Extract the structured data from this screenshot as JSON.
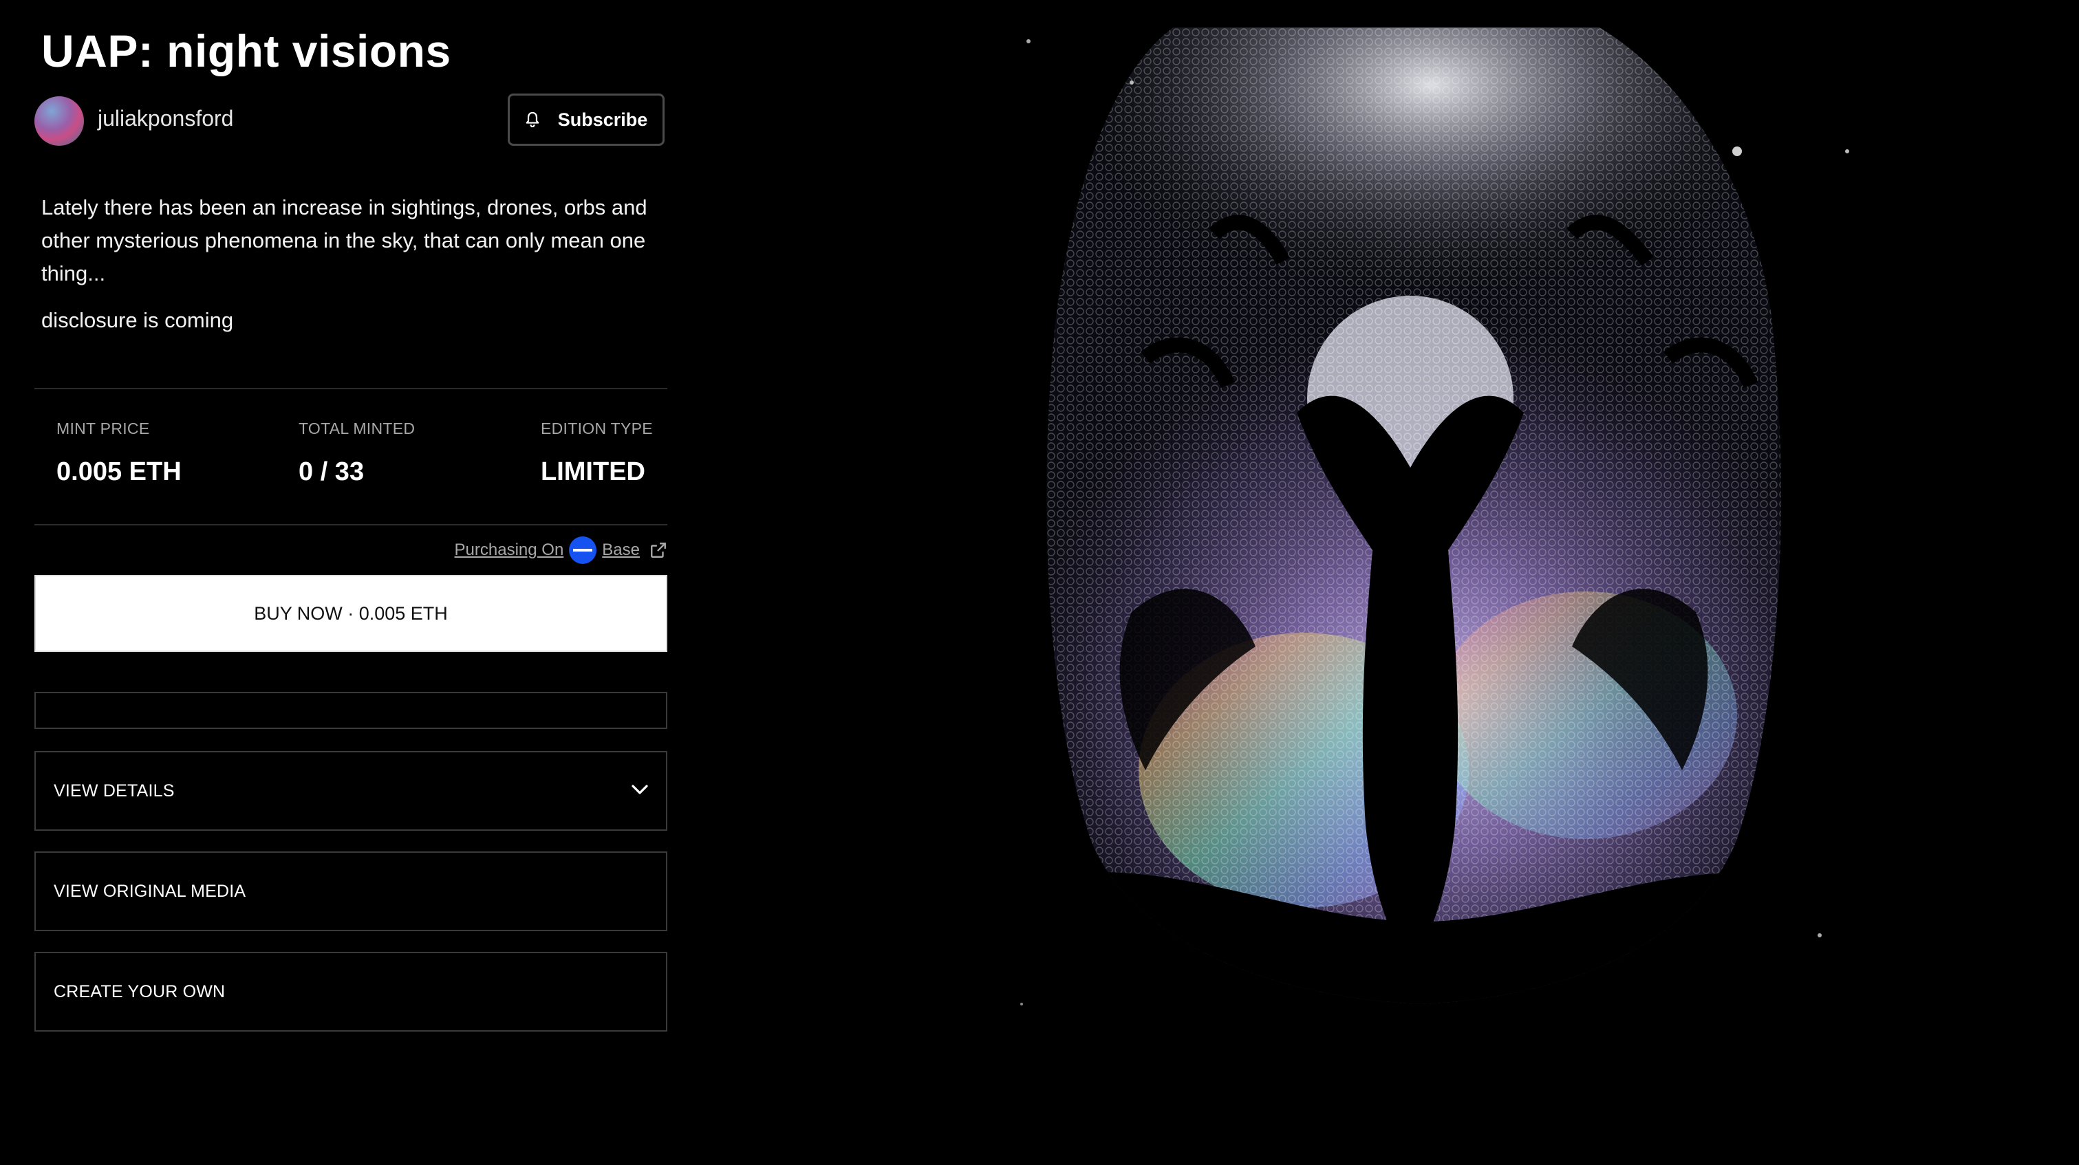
{
  "page": {
    "title": "UAP: night visions"
  },
  "creator": {
    "name": "juliakponsford",
    "avatar_icon": "avatar-gradient"
  },
  "subscribe": {
    "label": "Subscribe",
    "icon": "bell-icon"
  },
  "description": {
    "paragraphs": [
      "Lately there has been an increase in sightings, drones, orbs and other mysterious phenomena in the sky, that can only mean one thing...",
      "disclosure is coming"
    ]
  },
  "stats": {
    "mint_price": {
      "label": "MINT PRICE",
      "value": "0.005 ETH"
    },
    "total_minted": {
      "label": "TOTAL MINTED",
      "value": "0 / 33"
    },
    "edition_type": {
      "label": "EDITION TYPE",
      "value": "LIMITED"
    }
  },
  "purchasing": {
    "prefix": "Purchasing On",
    "network": "Base",
    "network_icon": "base-logo-icon",
    "link_icon": "external-link-icon",
    "network_color": "#1652f0"
  },
  "buy": {
    "label": "BUY NOW · 0.005 ETH"
  },
  "accordions": [
    {
      "label": "VIEW DETAILS",
      "icon": "chevron-down-icon"
    },
    {
      "label": "VIEW ORIGINAL MEDIA"
    },
    {
      "label": "CREATE YOUR OWN"
    }
  ],
  "artwork": {
    "description_icon": "artwork-image"
  }
}
